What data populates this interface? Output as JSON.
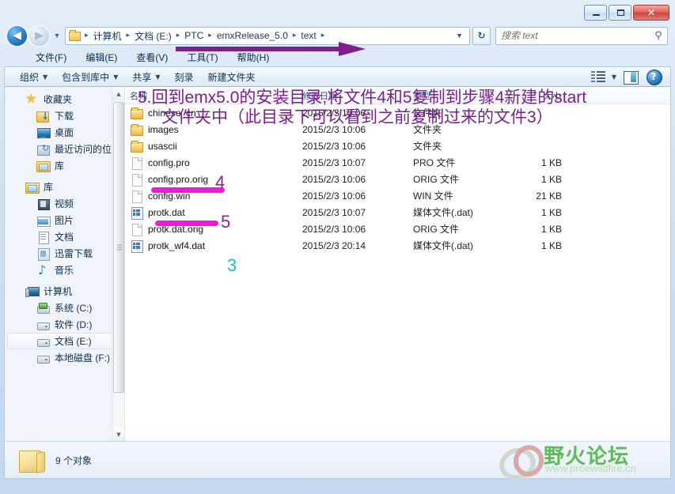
{
  "window": {
    "buttons": {
      "minimize": "minimize",
      "maximize": "maximize",
      "close": "✕"
    }
  },
  "address": {
    "back_icon": "◀",
    "forward_icon": "▶",
    "recent_dropdown_icon": "▼",
    "folder_icon": "folder-icon",
    "breadcrumbs": [
      "计算机",
      "文档 (E:)",
      "PTC",
      "emxRelease_5.0",
      "text"
    ],
    "separator": "▸",
    "dropdown_caret": "▼",
    "refresh_icon": "↻",
    "search_placeholder": "搜索 text",
    "search_value": "",
    "search_icon": "⚲"
  },
  "menubar": {
    "items": [
      "文件(F)",
      "编辑(E)",
      "查看(V)",
      "工具(T)",
      "帮助(H)"
    ]
  },
  "toolbar": {
    "items": [
      {
        "label": "组织",
        "caret": "▼"
      },
      {
        "label": "包含到库中",
        "caret": "▼"
      },
      {
        "label": "共享",
        "caret": "▼"
      },
      {
        "label": "刻录",
        "caret": ""
      },
      {
        "label": "新建文件夹",
        "caret": ""
      }
    ],
    "view_caret": "▼"
  },
  "sidebar": {
    "groups": [
      {
        "header": {
          "label": "收藏夹",
          "icon": "star-icon"
        },
        "items": [
          {
            "label": "下载",
            "icon": "download-folder-icon"
          },
          {
            "label": "桌面",
            "icon": "desktop-icon"
          },
          {
            "label": "最近访问的位置",
            "icon": "recent-places-icon"
          },
          {
            "label": "库",
            "icon": "library-icon"
          }
        ]
      },
      {
        "header": {
          "label": "库",
          "icon": "library-icon"
        },
        "items": [
          {
            "label": "视频",
            "icon": "video-icon"
          },
          {
            "label": "图片",
            "icon": "picture-icon"
          },
          {
            "label": "文档",
            "icon": "document-icon"
          },
          {
            "label": "迅雷下载",
            "icon": "thunder-download-icon"
          },
          {
            "label": "音乐",
            "icon": "music-icon"
          }
        ]
      },
      {
        "header": {
          "label": "计算机",
          "icon": "computer-icon"
        },
        "items": [
          {
            "label": "系统 (C:)",
            "icon": "system-drive-icon",
            "selected": false
          },
          {
            "label": "软件 (D:)",
            "icon": "drive-icon",
            "selected": false
          },
          {
            "label": "文档 (E:)",
            "icon": "drive-icon",
            "selected": true
          },
          {
            "label": "本地磁盘 (F:)",
            "icon": "drive-icon",
            "selected": false
          }
        ]
      }
    ],
    "scroll_up_icon": "▲",
    "scroll_down_icon": "▼"
  },
  "filelist": {
    "columns": [
      "名称",
      "修改日期",
      "类型",
      "大小"
    ],
    "rows": [
      {
        "name": "chinese_cn",
        "date": "2015/2/3 10:06",
        "type": "文件夹",
        "size": "",
        "icon": "folder-icon"
      },
      {
        "name": "images",
        "date": "2015/2/3 10:06",
        "type": "文件夹",
        "size": "",
        "icon": "folder-icon"
      },
      {
        "name": "usascii",
        "date": "2015/2/3 10:06",
        "type": "文件夹",
        "size": "",
        "icon": "folder-icon"
      },
      {
        "name": "config.pro",
        "date": "2015/2/3 10:07",
        "type": "PRO 文件",
        "size": "1 KB",
        "icon": "file-icon"
      },
      {
        "name": "config.pro.orig",
        "date": "2015/2/3 10:06",
        "type": "ORIG 文件",
        "size": "1 KB",
        "icon": "file-icon"
      },
      {
        "name": "config.win",
        "date": "2015/2/3 10:06",
        "type": "WIN 文件",
        "size": "21 KB",
        "icon": "file-icon"
      },
      {
        "name": "protk.dat",
        "date": "2015/2/3 10:07",
        "type": "媒体文件(.dat)",
        "size": "1 KB",
        "icon": "dat-file-icon"
      },
      {
        "name": "protk.dat.orig",
        "date": "2015/2/3 10:06",
        "type": "ORIG 文件",
        "size": "1 KB",
        "icon": "file-icon"
      },
      {
        "name": "protk_wf4.dat",
        "date": "2015/2/3 20:14",
        "type": "媒体文件(.dat)",
        "size": "1 KB",
        "icon": "dat-file-icon"
      }
    ]
  },
  "statusbar": {
    "text": "9 个对象",
    "folder_icon": "open-folder-icon"
  },
  "watermark": {
    "title": "野火论坛",
    "url": "www.proewildfire.cn"
  },
  "annotations": {
    "line1": "5.回到emx5.0的安装目录,将文件4和5复制到步骤4新建的start",
    "line2": "文件夹中（此目录下可以看到之前复制过来的文件3）",
    "num4": "4",
    "num5": "5",
    "num3": "3",
    "colors": {
      "purple": "#7a1f8f",
      "magenta": "#f21ad9",
      "cyan": "#12c3cc"
    }
  }
}
